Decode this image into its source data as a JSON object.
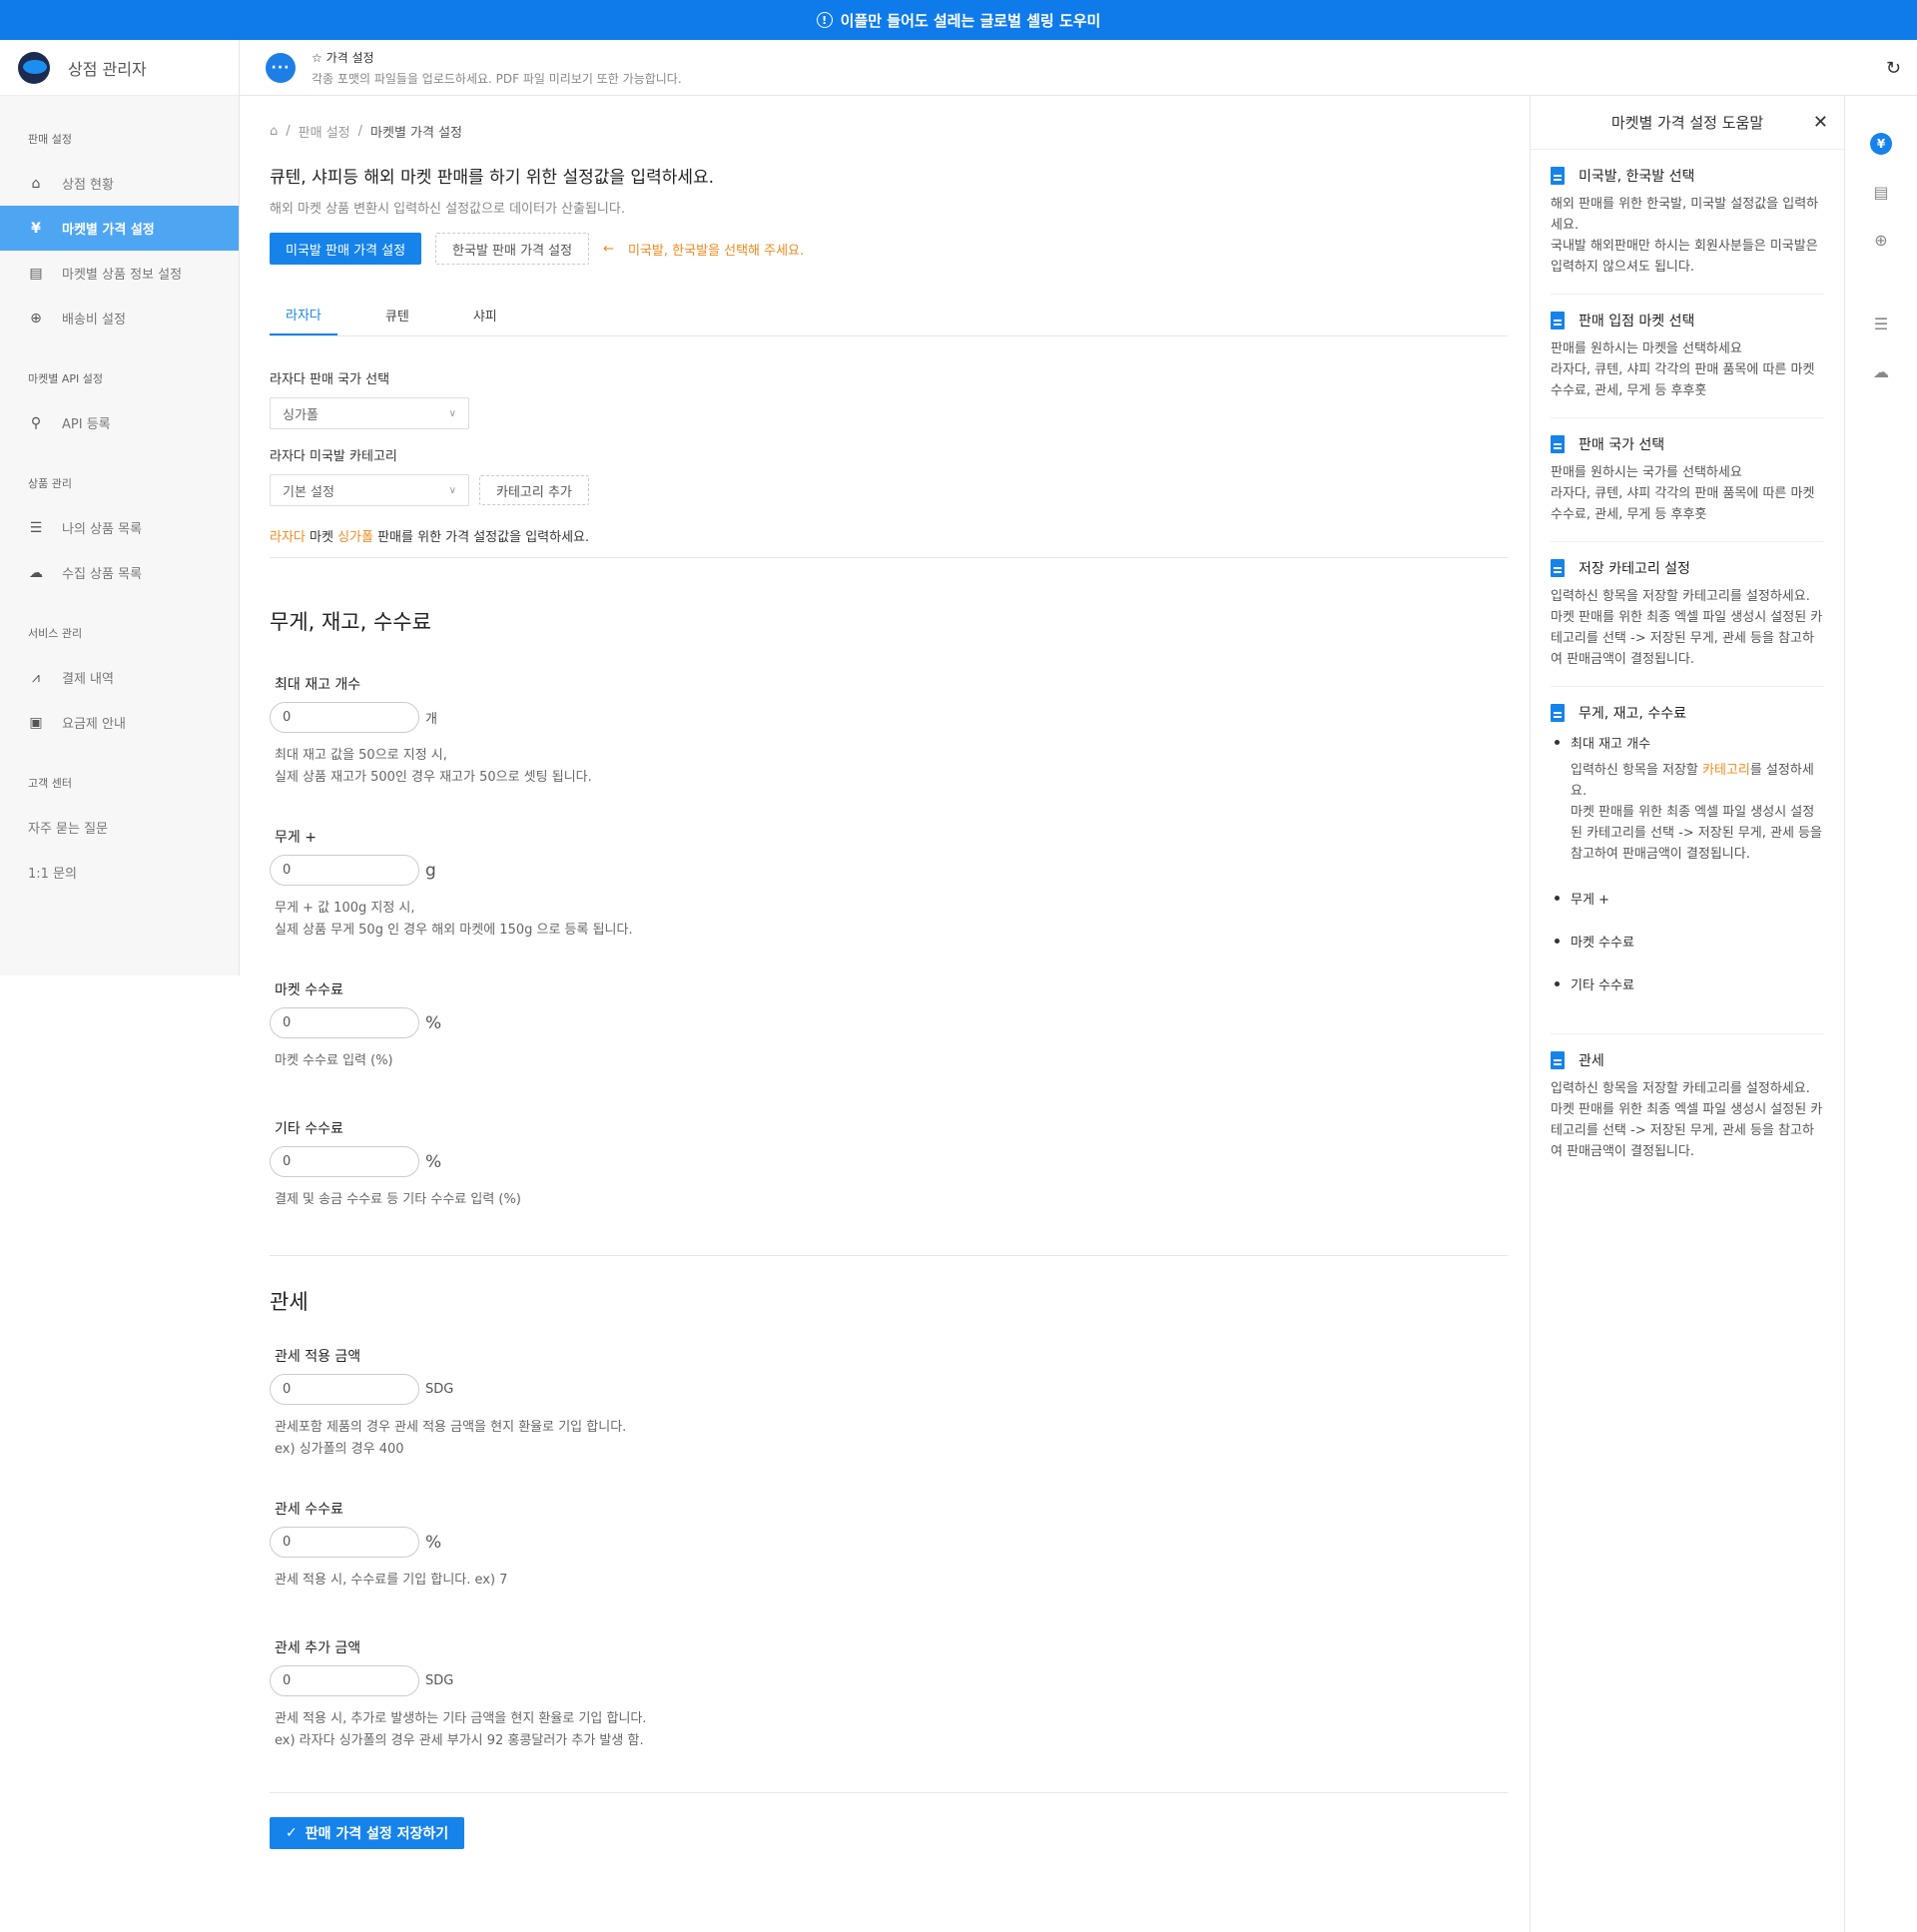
{
  "topbar": {
    "icon": "info-circle-icon",
    "text": "이플만 들어도 설레는 글로벌 셀링 도우미"
  },
  "app": {
    "title": "상점 관리자"
  },
  "header": {
    "title": "☆ 가격 설정",
    "subtitle": "각종 포맷의 파일들을 업로드하세요. PDF 파일 미리보기 또한 가능합니다."
  },
  "sidebar": {
    "groups": {
      "sales": "판매 설정",
      "api": "마켓별 API 설정",
      "products": "상품 관리",
      "service": "서비스 관리",
      "support": "고객 센터"
    },
    "items": {
      "store_status": "상점 현황",
      "market_price": "마켓별 가격 설정",
      "market_product_info": "마켓별 상품 정보 설정",
      "shipping": "배송비 설정",
      "api_register": "API 등록",
      "my_products": "나의 상품 목록",
      "collected_products": "수집 상품 목록",
      "payments": "결제 내역",
      "pricing": "요금제 안내",
      "faq": "자주 묻는 질문",
      "inquiry": "1:1 문의"
    }
  },
  "breadcrumb": [
    "판매 설정",
    "마켓별 가격 설정"
  ],
  "main": {
    "heading": "큐텐, 샤피등 해외 마켓 판매를 하기 위한 설정값을 입력하세요.",
    "subheading": "해외 마켓 상품 변환시 입력하신 설정값으로 데이터가 산출됩니다.",
    "btn_us": "미국발 판매 가격 설정",
    "btn_kr": "한국발 판매 가격 설정",
    "select_hint": "미국발, 한국발을 선택해 주세요.",
    "tabs": [
      "라자다",
      "큐텐",
      "샤피"
    ],
    "country_label": "라자다 판매 국가 선택",
    "country_value": "싱가폴",
    "category_label": "라자다 미국발 카테고리",
    "category_value": "기본 설정",
    "category_add": "카테고리 추가",
    "note": {
      "market": "라자다",
      "mid1": " 마켓 ",
      "country": "싱가폴",
      "rest": " 판매를 위한 가격 설정값을 입력하세요."
    }
  },
  "section1": {
    "title": "무게, 재고, 수수료",
    "max_stock": {
      "label": "최대 재고 개수",
      "value": "0",
      "unit": "개",
      "desc1": "최대 재고 값을 50으로 지정 시,",
      "desc2": "실제 상품 재고가 500인 경우 재고가 50으로 셋팅 됩니다."
    },
    "weight": {
      "label": "무게 +",
      "value": "0",
      "unit": "g",
      "desc1": "무게 + 값 100g 지정 시,",
      "desc2": "실제 상품 무게 50g 인 경우 해외 마켓에 150g 으로 등록 됩니다."
    },
    "market_fee": {
      "label": "마켓 수수료",
      "value": "0",
      "unit": "%",
      "desc1": "마켓 수수료 입력 (%)"
    },
    "other_fee": {
      "label": "기타 수수료",
      "value": "0",
      "unit": "%",
      "desc1": "결제 및 송금 수수료 등 기타 수수료 입력 (%)"
    }
  },
  "section2": {
    "title": "관세",
    "duty_amount": {
      "label": "관세 적용 금액",
      "value": "0",
      "unit": "SDG",
      "desc1": "관세포함 제품의 경우 관세 적용 금액을 현지 환율로 기입 합니다.",
      "desc2": "ex) 싱가폴의 경우 400"
    },
    "duty_fee": {
      "label": "관세 수수료",
      "value": "0",
      "unit": "%",
      "desc1": "관세 적용 시, 수수료를 기입 합니다. ex) 7"
    },
    "duty_extra": {
      "label": "관세 추가 금액",
      "value": "0",
      "unit": "SDG",
      "desc1": "관세 적용 시, 추가로 발생하는 기타 금액을 현지 환율로 기입 합니다.",
      "desc2": "ex) 라자다 싱가폴의 경우 관세 부가시 92 홍콩달러가 추가 발생 함."
    }
  },
  "save_label": "판매 가격 설정 저장하기",
  "help": {
    "title": "마켓별 가격 설정 도움말",
    "s1": {
      "title": "미국발, 한국발 선택",
      "b1": "해외 판매를 위한 한국발, 미국발 설정값을 입력하세요.",
      "b2": "국내발 해외판매만 하시는 회원사분들은 미국발은 입력하지 않으셔도 됩니다."
    },
    "s2": {
      "title": "판매 입점 마켓 선택",
      "b1": "판매를 원하시는 마켓을 선택하세요",
      "b2": "라자다, 큐텐, 샤피 각각의 판매 품목에 따른 마켓 수수료, 관세, 무게 등 후후훗"
    },
    "s3": {
      "title": "판매 국가 선택",
      "b1": "판매를 원하시는 국가를 선택하세요",
      "b2": "라자다, 큐텐, 샤피 각각의 판매 품목에 따른 마켓 수수료, 관세, 무게 등 후후훗"
    },
    "s4": {
      "title": "저장 카테고리 설정",
      "b1": "입력하신 항목을 저장할 카테고리를 설정하세요. 마켓 판매를 위한 최종 엑셀 파일 생성시 설정된 카테고리를 선택 -> 저장된 무게, 관세 등을 참고하여 판매금액이 결정됩니다."
    },
    "s5": {
      "title": "무게, 재고, 수수료",
      "li1": "최대 재고 개수",
      "li1_sub_a": "입력하신 항목을 저장할 ",
      "li1_sub_o": "카테고리",
      "li1_sub_b": "를 설정하세요.",
      "li1_sub_c": "마켓 판매를 위한 최종 엑셀 파일 생성시 설정된 카테고리를 선택 -> 저장된 무게, 관세 등을 참고하여 판매금액이 결정됩니다.",
      "li2": "무게 +",
      "li3": "마켓 수수료",
      "li4": "기타 수수료"
    },
    "s6": {
      "title": "관세",
      "b1": "입력하신 항목을 저장할 카테고리를 설정하세요. 마켓 판매를 위한 최종 엑셀 파일 생성시 설정된 카테고리를 선택 -> 저장된 무게, 관세 등을 참고하여 판매금액이 결정됩니다."
    }
  },
  "rail": {
    "icons": [
      "yen-icon",
      "store-icon",
      "globe-icon",
      "server-icon",
      "cloud-upload-icon"
    ]
  },
  "colors": {
    "primary": "#1683ea",
    "topbar": "#0f7bea",
    "accent_orange": "#f08a1c",
    "sidebar_active": "#4ea6f3"
  }
}
